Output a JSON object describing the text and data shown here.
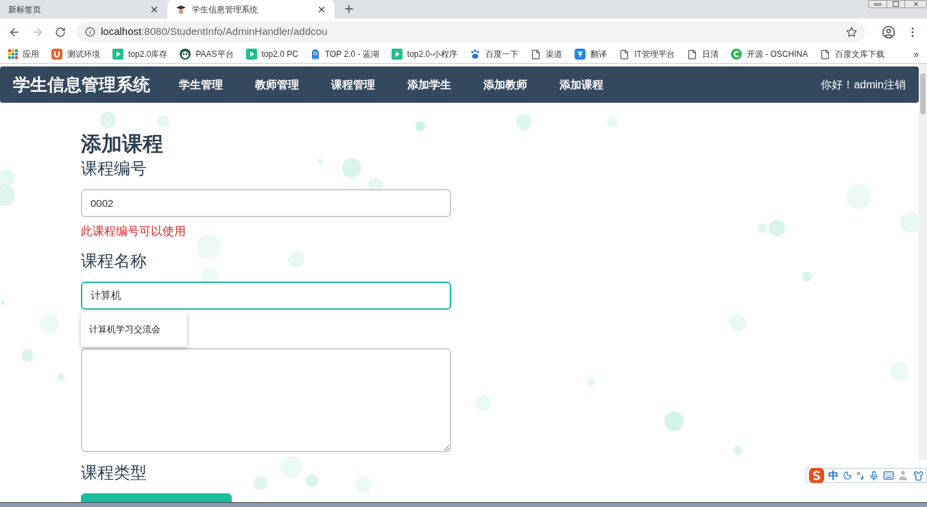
{
  "browser": {
    "tabs": [
      {
        "title": "新标签页",
        "selected": false
      },
      {
        "title": "学生信息管理系统",
        "selected": true
      }
    ],
    "url": {
      "host": "localhost",
      "path": ":8080/StudentInfo/AdminHandler/addcou"
    },
    "bookmarks": [
      {
        "label": "应用",
        "kind": "apps"
      },
      {
        "label": "测试环境",
        "kind": "u"
      },
      {
        "label": "top2.0库存",
        "kind": "play"
      },
      {
        "label": "PAAS平台",
        "kind": "panda"
      },
      {
        "label": "top2.0 PC",
        "kind": "play"
      },
      {
        "label": "TOP 2.0 - 蓝湖",
        "kind": "blue"
      },
      {
        "label": "top2.0-小程序",
        "kind": "play"
      },
      {
        "label": "百度一下",
        "kind": "paw"
      },
      {
        "label": "渠道",
        "kind": "page"
      },
      {
        "label": "翻译",
        "kind": "translate"
      },
      {
        "label": "IT管理平台",
        "kind": "page"
      },
      {
        "label": "日清",
        "kind": "page"
      },
      {
        "label": "开源 - OSCHINA",
        "kind": "osc"
      },
      {
        "label": "百度文库下载",
        "kind": "page"
      }
    ],
    "more": "»"
  },
  "navbar": {
    "brand": "学生信息管理系统",
    "items": [
      {
        "label": "学生管理"
      },
      {
        "label": "教师管理"
      },
      {
        "label": "课程管理"
      },
      {
        "label": "添加学生"
      },
      {
        "label": "添加教师"
      },
      {
        "label": "添加课程"
      }
    ],
    "user": "你好！admin注销"
  },
  "form": {
    "title": "添加课程",
    "fields": [
      {
        "kind": "input",
        "label": "课程编号",
        "value": "0002",
        "focused": false,
        "hint": "此课程编号可以使用"
      },
      {
        "kind": "input",
        "label": "课程名称",
        "value": "计算机",
        "focused": true,
        "suggestions": [
          "计算机学习交流会"
        ]
      },
      {
        "kind": "textarea"
      },
      {
        "kind": "select",
        "label": "课程类型"
      }
    ]
  },
  "ime": {
    "lang": "中"
  }
}
